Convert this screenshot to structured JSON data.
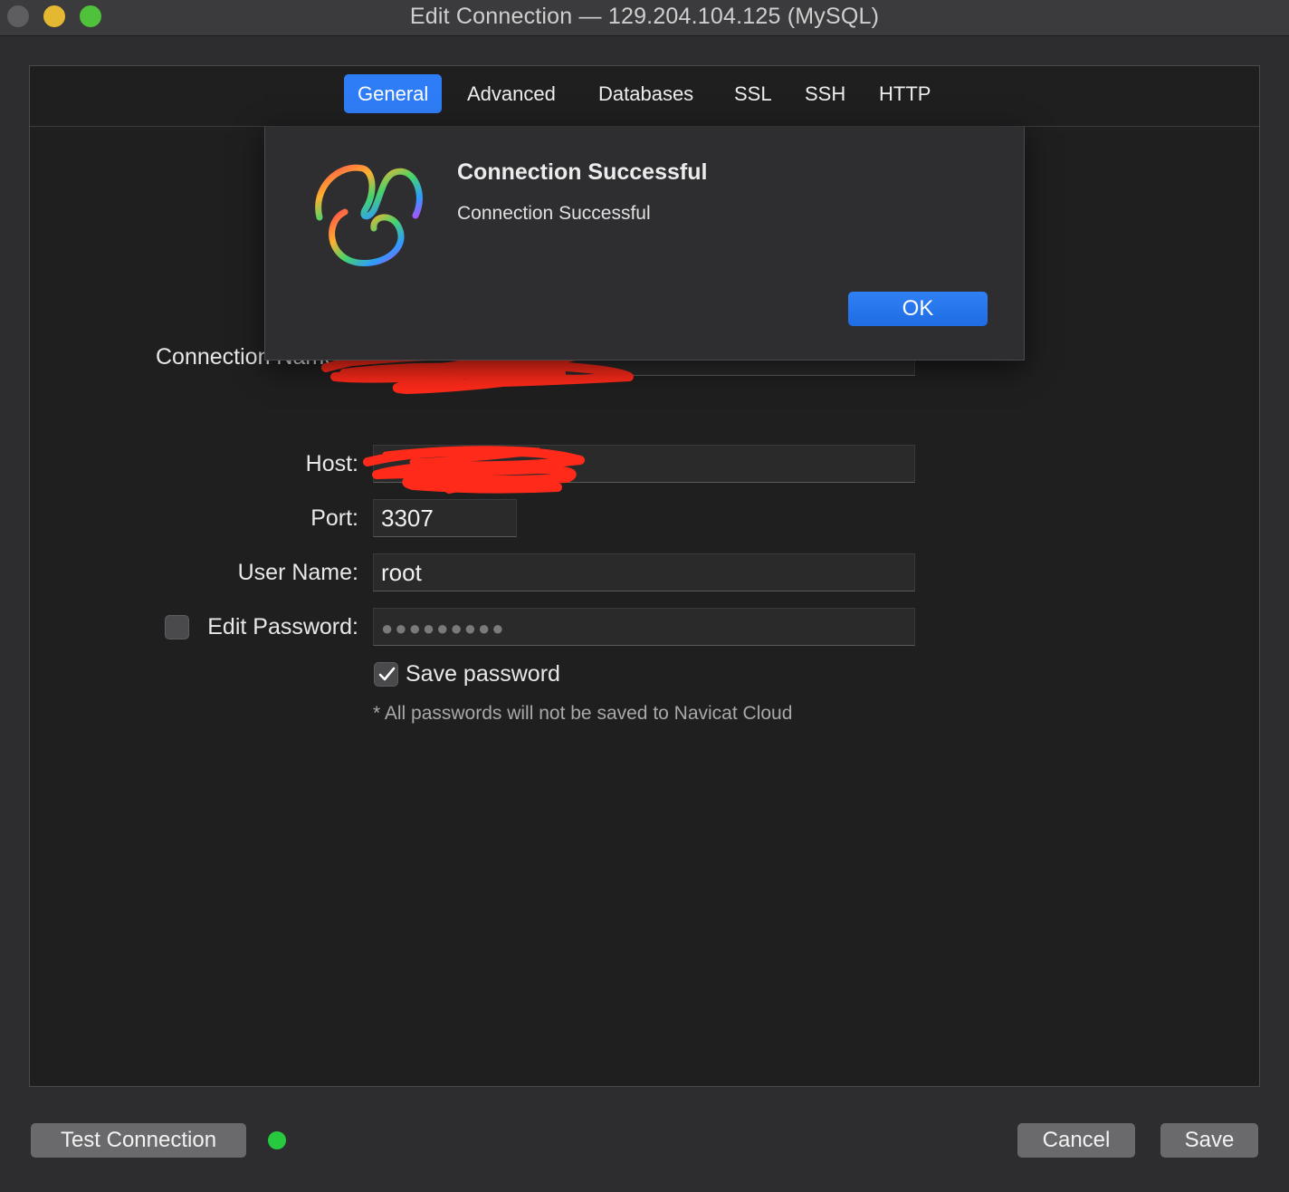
{
  "window": {
    "title": "Edit Connection — 129.204.104.125 (MySQL)"
  },
  "tabs": [
    {
      "label": "General",
      "active": true
    },
    {
      "label": "Advanced",
      "active": false
    },
    {
      "label": "Databases",
      "active": false
    },
    {
      "label": "SSL",
      "active": false
    },
    {
      "label": "SSH",
      "active": false
    },
    {
      "label": "HTTP",
      "active": false
    }
  ],
  "form": {
    "connection_name_label": "Connection Name:",
    "host_label": "Host:",
    "port_label": "Port:",
    "port_value": "3307",
    "username_label": "User Name:",
    "username_value": "root",
    "edit_password_label": "Edit Password:",
    "edit_password_checked": false,
    "password_masked": "●●●●●●●●●",
    "save_password_label": "Save password",
    "save_password_checked": true,
    "cloud_note": "* All passwords will not be saved to Navicat Cloud"
  },
  "dialog": {
    "title": "Connection Successful",
    "message": "Connection Successful",
    "ok_label": "OK",
    "icon": "navicat-logo-icon"
  },
  "footer": {
    "test_connection_label": "Test Connection",
    "status_color": "#27c93f",
    "cancel_label": "Cancel",
    "save_label": "Save"
  },
  "colors": {
    "accent": "#2f7df6",
    "redaction": "#ff2a1a"
  }
}
